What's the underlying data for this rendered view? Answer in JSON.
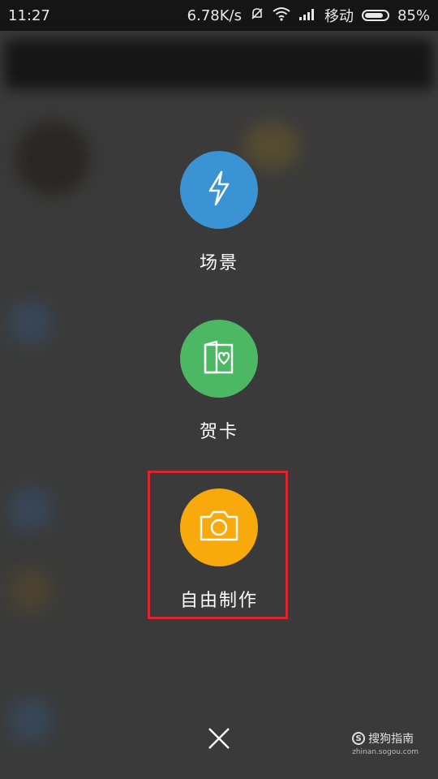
{
  "status_bar": {
    "time": "11:27",
    "speed": "6.78K/s",
    "carrier": "移动",
    "battery": "85%",
    "battery_level": 0.85
  },
  "menu": {
    "items": [
      {
        "label": "场景",
        "icon": "lightning-icon",
        "color": "#3a93d2"
      },
      {
        "label": "贺卡",
        "icon": "greeting-card-icon",
        "color": "#4db864"
      },
      {
        "label": "自由制作",
        "icon": "camera-icon",
        "color": "#f8a90c"
      }
    ]
  },
  "highlight": {
    "color": "#d8262c"
  },
  "close": {
    "icon": "close-icon"
  },
  "watermark": {
    "brand": "搜狗指南",
    "url": "zhinan.sogou.com"
  }
}
